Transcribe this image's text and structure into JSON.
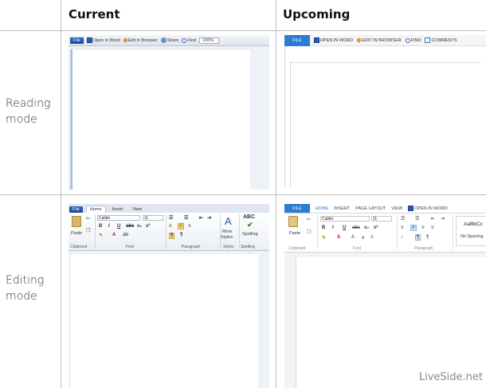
{
  "headers": {
    "current": "Current",
    "upcoming": "Upcoming"
  },
  "rows": {
    "reading_l1": "Reading",
    "reading_l2": "mode",
    "editing_l1": "Editing",
    "editing_l2": "mode"
  },
  "current_reading": {
    "file": "File",
    "open_in_word": "Open in Word",
    "edit_in_browser": "Edit in Browser",
    "share": "Share",
    "find": "Find",
    "zoom": "100%"
  },
  "upcoming_reading": {
    "file": "FILE",
    "open_in_word": "OPEN IN WORD",
    "edit_in_browser": "EDIT IN BROWSER",
    "find": "FIND",
    "comments": "COMMENTS"
  },
  "current_editing": {
    "tabs": [
      "File",
      "Home",
      "Insert",
      "View"
    ],
    "paste": "Paste",
    "font_name": "Calibri",
    "font_size": "11",
    "more_styles_1": "More",
    "more_styles_2": "Styles",
    "spelling": "Spelling",
    "groups": {
      "clipboard": "Clipboard",
      "font": "Font",
      "paragraph": "Paragraph",
      "styles": "Styles",
      "spelling": "Spelling"
    }
  },
  "upcoming_editing": {
    "tabs": [
      "FILE",
      "HOME",
      "INSERT",
      "PAGE LAYOUT",
      "VIEW"
    ],
    "open_in_word": "OPEN IN WORD",
    "paste": "Paste",
    "font_name": "Calibri",
    "font_size": "11",
    "style_sample": "AaBbCc",
    "style_name": "No Spacing",
    "groups": {
      "clipboard": "Clipboard",
      "font": "Font",
      "paragraph": "Paragraph"
    }
  },
  "watermark": "LiveSide.net",
  "colors": {
    "file_old": "#1b4a9a",
    "file_new": "#2b7cd3",
    "grid": "#bdbdbd"
  }
}
